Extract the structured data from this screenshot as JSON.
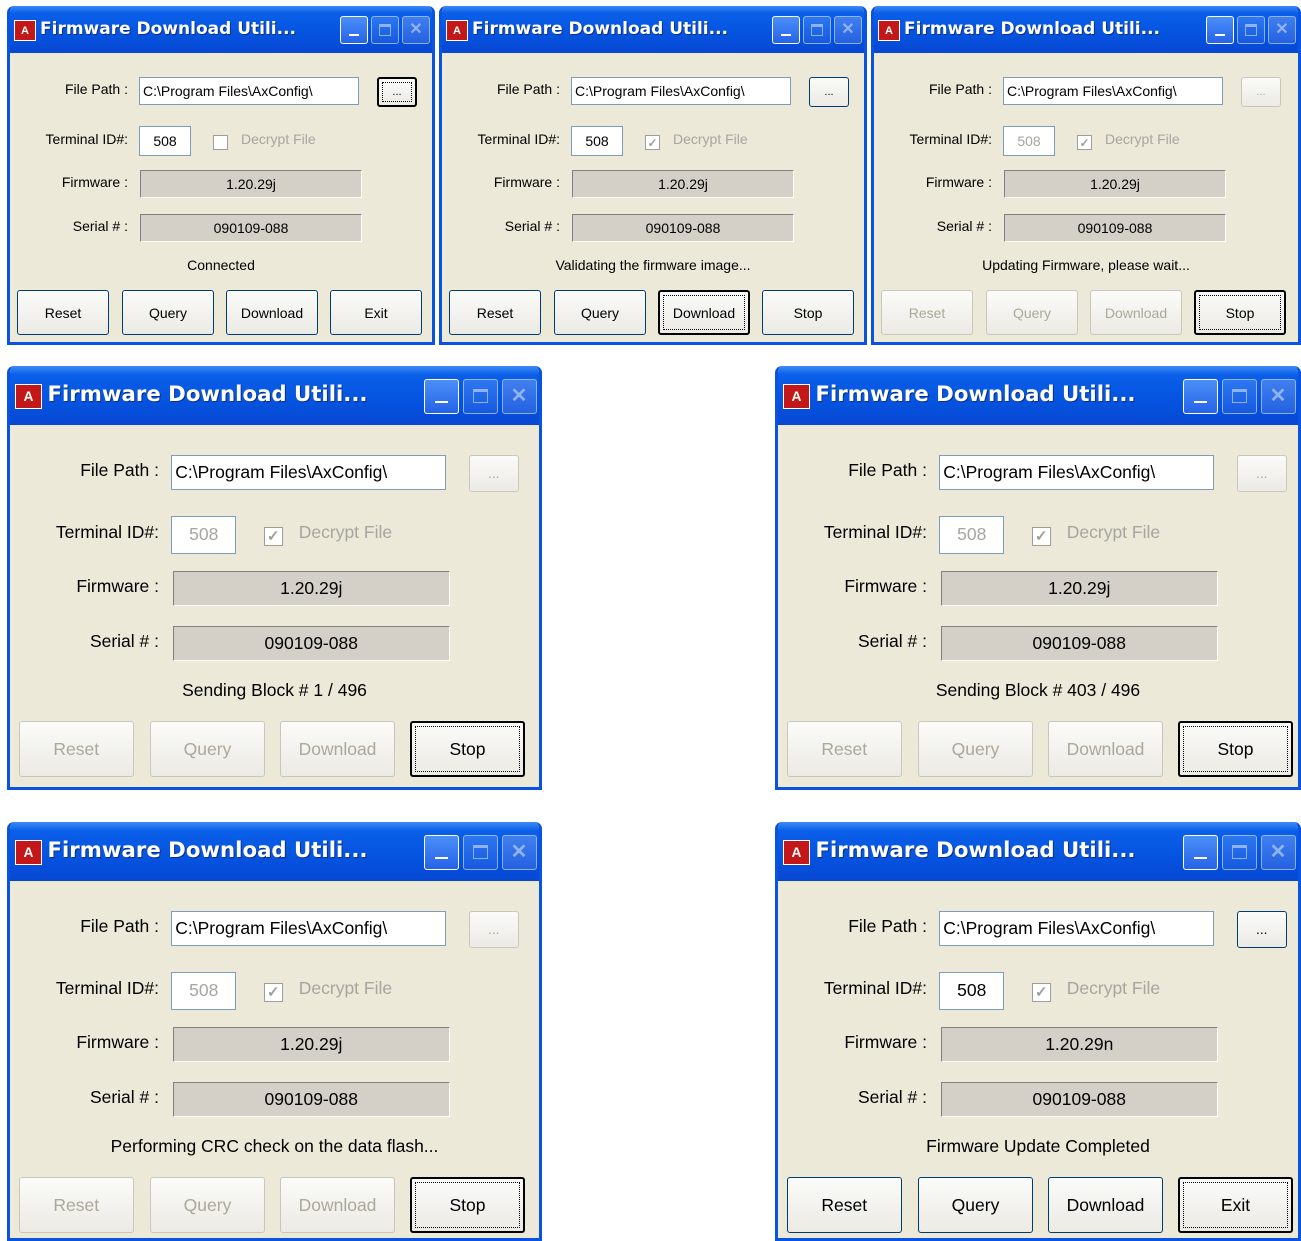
{
  "windows": [
    {
      "title": "Firmware Download Utili...",
      "file_path_label": "File Path :",
      "file_path_value": "C:\\Program Files\\AxConfig\\",
      "browse_label": "...",
      "terminal_label": "Terminal ID#:",
      "terminal_value": "508",
      "decrypt_label": "Decrypt File",
      "decrypt_checked": false,
      "firmware_label": "Firmware :",
      "firmware_value": "1.20.29j",
      "serial_label": "Serial # :",
      "serial_value": "090109-088",
      "status": "Connected",
      "buttons": [
        "Reset",
        "Query",
        "Download",
        "Exit"
      ]
    },
    {
      "title": "Firmware Download Utili...",
      "file_path_label": "File Path :",
      "file_path_value": "C:\\Program Files\\AxConfig\\",
      "browse_label": "...",
      "terminal_label": "Terminal ID#:",
      "terminal_value": "508",
      "decrypt_label": "Decrypt File",
      "decrypt_checked": true,
      "firmware_label": "Firmware :",
      "firmware_value": "1.20.29j",
      "serial_label": "Serial # :",
      "serial_value": "090109-088",
      "status": "Validating the firmware image...",
      "buttons": [
        "Reset",
        "Query",
        "Download",
        "Stop"
      ]
    },
    {
      "title": "Firmware Download Utili...",
      "file_path_label": "File Path :",
      "file_path_value": "C:\\Program Files\\AxConfig\\",
      "browse_label": "...",
      "terminal_label": "Terminal ID#:",
      "terminal_value": "508",
      "decrypt_label": "Decrypt File",
      "decrypt_checked": true,
      "firmware_label": "Firmware :",
      "firmware_value": "1.20.29j",
      "serial_label": "Serial # :",
      "serial_value": "090109-088",
      "status": "Updating Firmware, please wait...",
      "buttons": [
        "Reset",
        "Query",
        "Download",
        "Stop"
      ]
    },
    {
      "title": "Firmware Download Utili...",
      "file_path_label": "File Path :",
      "file_path_value": "C:\\Program Files\\AxConfig\\",
      "browse_label": "...",
      "terminal_label": "Terminal ID#:",
      "terminal_value": "508",
      "decrypt_label": "Decrypt File",
      "decrypt_checked": true,
      "firmware_label": "Firmware :",
      "firmware_value": "1.20.29j",
      "serial_label": "Serial # :",
      "serial_value": "090109-088",
      "status": "Sending Block # 1 / 496",
      "buttons": [
        "Reset",
        "Query",
        "Download",
        "Stop"
      ]
    },
    {
      "title": "Firmware Download Utili...",
      "file_path_label": "File Path :",
      "file_path_value": "C:\\Program Files\\AxConfig\\",
      "browse_label": "...",
      "terminal_label": "Terminal ID#:",
      "terminal_value": "508",
      "decrypt_label": "Decrypt File",
      "decrypt_checked": true,
      "firmware_label": "Firmware :",
      "firmware_value": "1.20.29j",
      "serial_label": "Serial # :",
      "serial_value": "090109-088",
      "status": "Sending Block # 403 / 496",
      "buttons": [
        "Reset",
        "Query",
        "Download",
        "Stop"
      ]
    },
    {
      "title": "Firmware Download Utili...",
      "file_path_label": "File Path :",
      "file_path_value": "C:\\Program Files\\AxConfig\\",
      "browse_label": "...",
      "terminal_label": "Terminal ID#:",
      "terminal_value": "508",
      "decrypt_label": "Decrypt File",
      "decrypt_checked": true,
      "firmware_label": "Firmware :",
      "firmware_value": "1.20.29j",
      "serial_label": "Serial # :",
      "serial_value": "090109-088",
      "status": "Performing CRC check on the data flash...",
      "buttons": [
        "Reset",
        "Query",
        "Download",
        "Stop"
      ]
    },
    {
      "title": "Firmware Download Utili...",
      "file_path_label": "File Path :",
      "file_path_value": "C:\\Program Files\\AxConfig\\",
      "browse_label": "...",
      "terminal_label": "Terminal ID#:",
      "terminal_value": "508",
      "decrypt_label": "Decrypt File",
      "decrypt_checked": true,
      "firmware_label": "Firmware :",
      "firmware_value": "1.20.29n",
      "serial_label": "Serial # :",
      "serial_value": "090109-088",
      "status": "Firmware Update Completed",
      "buttons": [
        "Reset",
        "Query",
        "Download",
        "Exit"
      ]
    }
  ]
}
